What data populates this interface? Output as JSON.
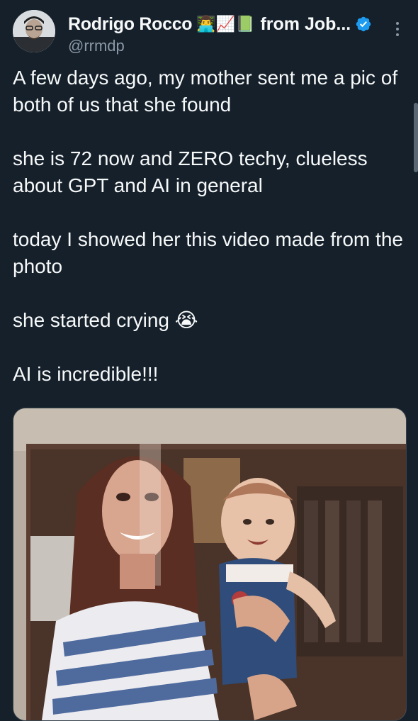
{
  "author": {
    "display_name": "Rodrigo Rocco",
    "name_emojis": "👨‍💻📈📗",
    "name_suffix": "from Job...",
    "handle": "@rrmdp",
    "verified": true,
    "verified_color": "#1d9bf0"
  },
  "tweet": {
    "paragraphs": [
      "A few days ago, my mother sent me a pic of both of us that she found",
      "she is 72 now and ZERO techy, clueless about GPT and AI in general",
      "today I showed her this video made from the photo",
      "she started crying 😭",
      "AI is incredible!!!"
    ]
  },
  "media": {
    "type": "photo",
    "alt": ""
  },
  "icons": {
    "more": "more-vertical-icon",
    "verified": "verified-badge-icon",
    "avatar": "avatar"
  },
  "theme": {
    "background": "#15202b",
    "text": "#f7f9f9",
    "secondary_text": "#8b98a5",
    "accent": "#1d9bf0"
  }
}
